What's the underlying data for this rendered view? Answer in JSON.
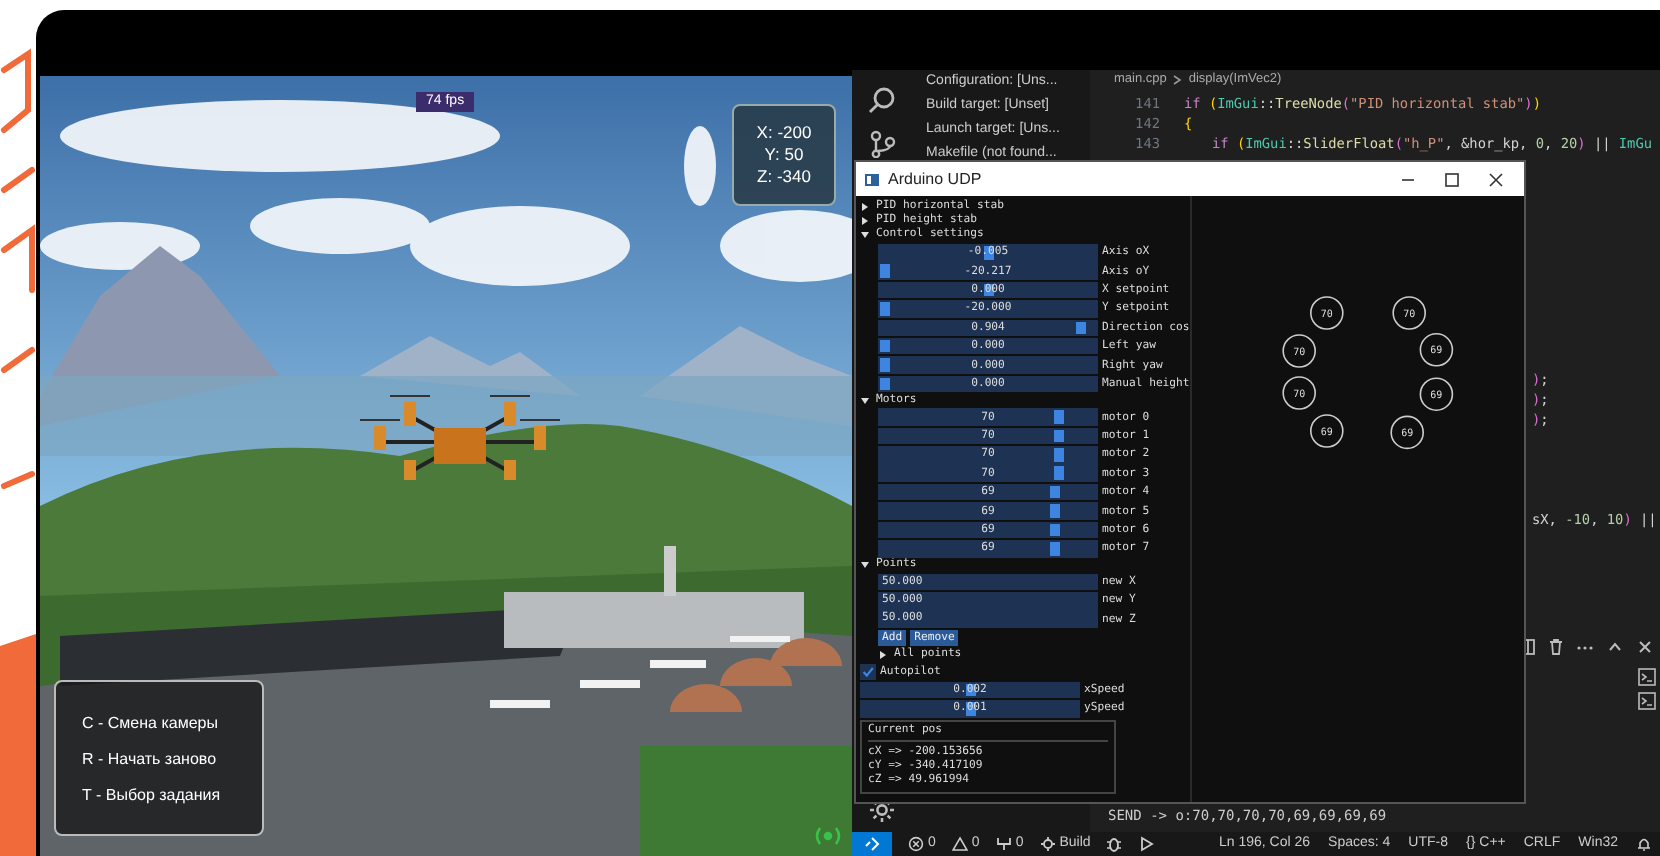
{
  "game": {
    "fps": "74 fps",
    "coords": [
      "X: -200",
      "Y: 50",
      "Z: -340"
    ],
    "help": [
      "C - Смена камеры",
      "R - Начать заново",
      "T - Выбор задания"
    ]
  },
  "sidebar": {
    "items": [
      "Configuration: [Uns...",
      "Build target: [Unset]",
      "Launch target: [Uns...",
      "Makefile (not found..."
    ]
  },
  "editor": {
    "breadcrumb": [
      "main.cpp",
      "display(ImVec2)"
    ],
    "lines": [
      {
        "number": "141",
        "tokens": [
          {
            "kind": "keyword",
            "text": "if "
          },
          {
            "kind": "paren",
            "text": "("
          },
          {
            "kind": "type",
            "text": "ImGui"
          },
          {
            "kind": "plain",
            "text": "::"
          },
          {
            "kind": "function",
            "text": "TreeNode"
          },
          {
            "kind": "paren2",
            "text": "("
          },
          {
            "kind": "string",
            "text": "\"PID horizontal stab\""
          },
          {
            "kind": "paren2",
            "text": ")"
          },
          {
            "kind": "paren",
            "text": ")"
          }
        ]
      },
      {
        "number": "142",
        "tokens": [
          {
            "kind": "paren",
            "text": "{"
          }
        ]
      },
      {
        "number": "143",
        "indented": true,
        "tokens": [
          {
            "kind": "keyword",
            "text": "if "
          },
          {
            "kind": "paren",
            "text": "("
          },
          {
            "kind": "type",
            "text": "ImGui"
          },
          {
            "kind": "plain",
            "text": "::"
          },
          {
            "kind": "function",
            "text": "SliderFloat"
          },
          {
            "kind": "paren2",
            "text": "("
          },
          {
            "kind": "string",
            "text": "\"h_P\""
          },
          {
            "kind": "plain",
            "text": ", &hor_kp, "
          },
          {
            "kind": "number",
            "text": "0"
          },
          {
            "kind": "plain",
            "text": ", "
          },
          {
            "kind": "number",
            "text": "20"
          },
          {
            "kind": "paren2",
            "text": ")"
          },
          {
            "kind": "plain",
            "text": " || "
          },
          {
            "kind": "type",
            "text": "ImGu"
          }
        ]
      }
    ],
    "fragments": [
      [
        {
          "kind": "paren2",
          "text": ")"
        },
        {
          "kind": "plain",
          "text": ";"
        }
      ],
      [
        {
          "kind": "paren2",
          "text": ")"
        },
        {
          "kind": "plain",
          "text": ";"
        }
      ],
      [
        {
          "kind": "paren2",
          "text": ")"
        },
        {
          "kind": "plain",
          "text": ";"
        }
      ],
      [
        {
          "kind": "plain",
          "text": "sX, "
        },
        {
          "kind": "number",
          "text": "-10"
        },
        {
          "kind": "plain",
          "text": ", "
        },
        {
          "kind": "number",
          "text": "10"
        },
        {
          "kind": "paren2",
          "text": ")"
        },
        {
          "kind": "plain",
          "text": " ||"
        }
      ]
    ]
  },
  "imgui_window": {
    "title": "Arduino UDP",
    "items": [
      {
        "kind": "tree",
        "label": "PID horizontal stab",
        "expanded": false
      },
      {
        "kind": "tree",
        "label": "PID height stab",
        "expanded": false
      },
      {
        "kind": "tree",
        "label": "Control settings",
        "expanded": true,
        "children": [
          {
            "kind": "slider",
            "value": "-0.005",
            "label": "Axis oX",
            "level": 0.5
          },
          {
            "kind": "slider",
            "value": "-20.217",
            "label": "Axis oY",
            "level": 0
          },
          {
            "kind": "slider",
            "value": "0.000",
            "label": "X setpoint",
            "level": 0.5
          },
          {
            "kind": "slider",
            "value": "-20.000",
            "label": "Y setpoint",
            "level": 0
          },
          {
            "kind": "slider",
            "value": "0.904",
            "label": "Direction cos",
            "level": 0.95
          },
          {
            "kind": "slider",
            "value": "0.000",
            "label": "Left yaw",
            "level": 0
          },
          {
            "kind": "slider",
            "value": "0.000",
            "label": "Right yaw",
            "level": 0
          },
          {
            "kind": "slider",
            "value": "0.000",
            "label": "Manual height",
            "level": 0
          }
        ]
      },
      {
        "kind": "tree",
        "label": "Motors",
        "expanded": true,
        "children": [
          {
            "kind": "slider",
            "value": "70",
            "label": "motor 0",
            "level": 0.84
          },
          {
            "kind": "slider",
            "value": "70",
            "label": "motor 1",
            "level": 0.84
          },
          {
            "kind": "slider",
            "value": "70",
            "label": "motor 2",
            "level": 0.84
          },
          {
            "kind": "slider",
            "value": "70",
            "label": "motor 3",
            "level": 0.84
          },
          {
            "kind": "slider",
            "value": "69",
            "label": "motor 4",
            "level": 0.83
          },
          {
            "kind": "slider",
            "value": "69",
            "label": "motor 5",
            "level": 0.83
          },
          {
            "kind": "slider",
            "value": "69",
            "label": "motor 6",
            "level": 0.83
          },
          {
            "kind": "slider",
            "value": "69",
            "label": "motor 7",
            "level": 0.83
          }
        ]
      },
      {
        "kind": "tree",
        "label": "Points",
        "expanded": true,
        "children": [
          {
            "kind": "input",
            "value": "50.000",
            "label": "new X"
          },
          {
            "kind": "input",
            "value": "50.000",
            "label": "new Y"
          },
          {
            "kind": "input",
            "value": "50.000",
            "label": "new Z"
          },
          {
            "kind": "buttons",
            "labels": [
              "Add",
              "Remove"
            ]
          },
          {
            "kind": "tree",
            "label": "All points",
            "expanded": false
          }
        ]
      },
      {
        "kind": "checkbox",
        "label": "Autopilot",
        "checked": true
      },
      {
        "kind": "slider",
        "value": "0.002",
        "label": "xSpeed",
        "level": 0.5
      },
      {
        "kind": "slider",
        "value": "0.001",
        "label": "ySpeed",
        "level": 0.5
      },
      {
        "kind": "child",
        "title": "Current pos",
        "lines": [
          "cX => -200.153656",
          "cY => -340.417109",
          "cZ => 49.961994"
        ]
      }
    ],
    "rotor_gauges": [
      "70",
      "70",
      "70",
      "70",
      "69",
      "69",
      "69",
      "69"
    ]
  },
  "terminal": {
    "output": "SEND -> o:70,70,70,70,69,69,69,69"
  },
  "status_bar": {
    "left": [
      {
        "kind": "errors",
        "text": "0"
      },
      {
        "kind": "warnings",
        "text": "0"
      },
      {
        "kind": "ports",
        "text": "0"
      },
      {
        "kind": "build",
        "text": "Build"
      },
      {
        "kind": "debug"
      },
      {
        "kind": "run"
      }
    ],
    "right": [
      "Ln 196, Col 26",
      "Spaces: 4",
      "UTF-8",
      "{} C++",
      "CRLF",
      "Win32"
    ]
  }
}
